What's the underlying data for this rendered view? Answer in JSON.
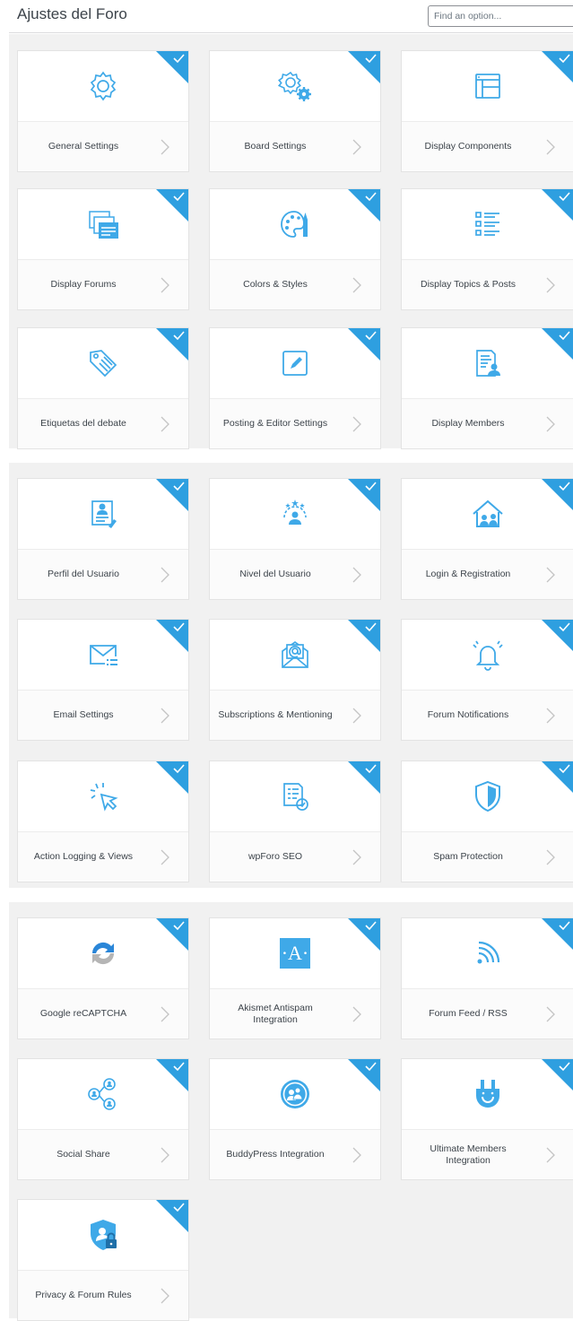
{
  "header": {
    "title": "Ajustes del Foro",
    "search_placeholder": "Find an option..."
  },
  "colors": {
    "accent": "#3fa9e8",
    "badge": "#2e9fe0",
    "page_bg": "#f1f1f1",
    "card_bg": "#ffffff"
  },
  "sections": [
    [
      {
        "label": "General Settings",
        "icon": "gear-icon"
      },
      {
        "label": "Board Settings",
        "icon": "gears-icon"
      },
      {
        "label": "Display Components",
        "icon": "browser-window-icon"
      },
      {
        "label": "Display Forums",
        "icon": "stacked-windows-icon"
      },
      {
        "label": "Colors & Styles",
        "icon": "palette-icon"
      },
      {
        "label": "Display Topics & Posts",
        "icon": "list-icon"
      },
      {
        "label": "Etiquetas del debate",
        "icon": "tags-icon"
      },
      {
        "label": "Posting & Editor Settings",
        "icon": "edit-pencil-icon"
      },
      {
        "label": "Display Members",
        "icon": "member-document-icon"
      }
    ],
    [
      {
        "label": "Perfil del Usuario",
        "icon": "user-profile-icon"
      },
      {
        "label": "Nivel del Usuario",
        "icon": "user-stars-icon"
      },
      {
        "label": "Login & Registration",
        "icon": "home-users-icon"
      },
      {
        "label": "Email Settings",
        "icon": "envelope-list-icon"
      },
      {
        "label": "Subscriptions & Mentioning",
        "icon": "at-envelope-icon"
      },
      {
        "label": "Forum Notifications",
        "icon": "bell-icon"
      },
      {
        "label": "Action Logging & Views",
        "icon": "cursor-click-icon"
      },
      {
        "label": "wpForo SEO",
        "icon": "seo-document-icon"
      },
      {
        "label": "Spam Protection",
        "icon": "shield-icon"
      }
    ],
    [
      {
        "label": "Google reCAPTCHA",
        "icon": "recaptcha-icon"
      },
      {
        "label": "Akismet Antispam Integration",
        "icon": "akismet-icon",
        "icon_text": "·A·"
      },
      {
        "label": "Forum Feed / RSS",
        "icon": "rss-icon"
      },
      {
        "label": "Social Share",
        "icon": "share-users-icon"
      },
      {
        "label": "BuddyPress Integration",
        "icon": "buddypress-icon"
      },
      {
        "label": "Ultimate Members Integration",
        "icon": "plug-smile-icon"
      },
      {
        "label": "Privacy & Forum Rules",
        "icon": "privacy-shield-icon"
      }
    ]
  ]
}
